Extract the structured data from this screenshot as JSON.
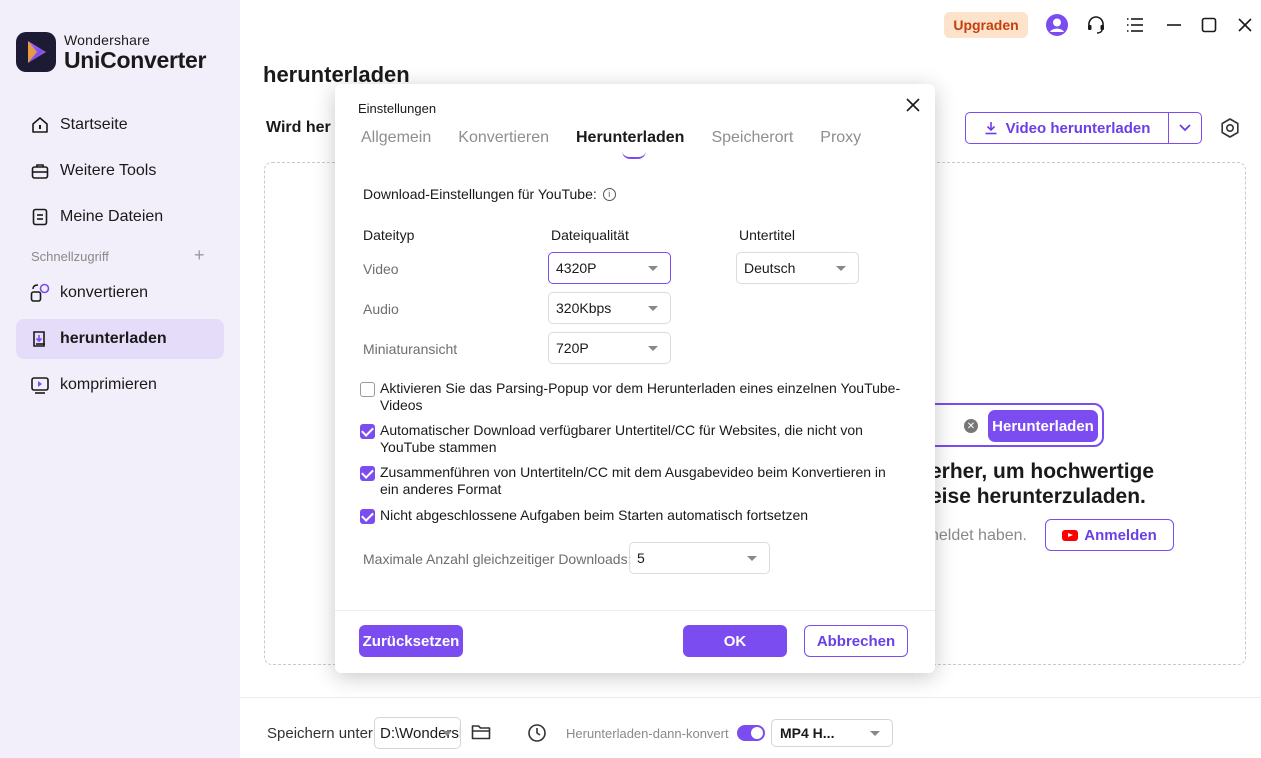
{
  "app": {
    "brand_small": "Wondershare",
    "brand_name": "UniConverter"
  },
  "sidebar": {
    "items": [
      {
        "label": "Startseite",
        "icon": "home-icon"
      },
      {
        "label": "Weitere Tools",
        "icon": "toolbox-icon"
      },
      {
        "label": "Meine Dateien",
        "icon": "file-icon"
      }
    ],
    "quick_access_label": "Schnellzugriff",
    "quick_items": [
      {
        "label": "konvertieren",
        "icon": "convert-icon"
      },
      {
        "label": "herunterladen",
        "icon": "download-icon",
        "active": true
      },
      {
        "label": "komprimieren",
        "icon": "compress-icon"
      }
    ]
  },
  "titlebar": {
    "upgrade_label": "Upgraden"
  },
  "main": {
    "page_title": "herunterladen",
    "subheading": "Wird her",
    "video_download_button": "Video herunterladen",
    "search_button": "Herunterladen",
    "headline_line1": "erher, um hochwertige",
    "headline_line2": "eise herunterzuladen.",
    "login_hint": "neldet haben.",
    "login_button": "Anmelden"
  },
  "bottom": {
    "save_label": "Speichern unter",
    "save_path": "D:\\Wondershare",
    "convert_label": "Herunterladen-dann-konvertieren",
    "toggle_on": true,
    "format": "MP4 H..."
  },
  "dialog": {
    "title": "Einstellungen",
    "tabs": [
      "Allgemein",
      "Konvertieren",
      "Herunterladen",
      "Speicherort",
      "Proxy"
    ],
    "active_tab": "Herunterladen",
    "section_title": "Download-Einstellungen für YouTube:",
    "columns": {
      "type": "Dateityp",
      "quality": "Dateiqualität",
      "subtitle": "Untertitel"
    },
    "rows": [
      {
        "label": "Video",
        "quality": "4320P"
      },
      {
        "label": "Audio",
        "quality": "320Kbps"
      },
      {
        "label": "Miniaturansicht",
        "quality": "720P"
      }
    ],
    "subtitle_value": "Deutsch",
    "checkboxes": [
      {
        "label": "Aktivieren Sie das Parsing-Popup vor dem Herunterladen eines einzelnen YouTube-Videos",
        "checked": false
      },
      {
        "label": "Automatischer Download verfügbarer Untertitel/CC für Websites, die nicht von YouTube stammen",
        "checked": true
      },
      {
        "label": "Zusammenführen von Untertiteln/CC mit dem Ausgabevideo beim Konvertieren in ein anderes Format",
        "checked": true
      },
      {
        "label": "Nicht abgeschlossene Aufgaben beim Starten automatisch fortsetzen",
        "checked": true
      }
    ],
    "max_downloads_label": "Maximale Anzahl gleichzeitiger Downloads:",
    "max_downloads_value": "5",
    "reset_label": "Zurücksetzen",
    "ok_label": "OK",
    "cancel_label": "Abbrechen"
  },
  "colors": {
    "accent": "#7b4cf0",
    "sidebar_bg": "#f2effa",
    "active_bg": "#e4dcf8",
    "upgrade_bg": "#fde2cc",
    "upgrade_text": "#c2410c"
  }
}
